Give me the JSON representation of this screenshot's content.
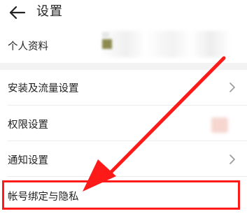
{
  "header": {
    "title": "设置",
    "back_icon": "arrow-left-icon"
  },
  "rows": {
    "profile": {
      "label": "个人资料"
    },
    "install_traffic": {
      "label": "安装及流量设置",
      "icon": "chevron-right-icon"
    },
    "permissions": {
      "label": "权限设置"
    },
    "notifications": {
      "label": "通知设置",
      "icon": "chevron-right-icon"
    },
    "account_privacy": {
      "label": "帐号绑定与隐私"
    }
  },
  "annotation": {
    "arrow_color": "#ff1a1a",
    "box_color": "#ff1a1a"
  }
}
